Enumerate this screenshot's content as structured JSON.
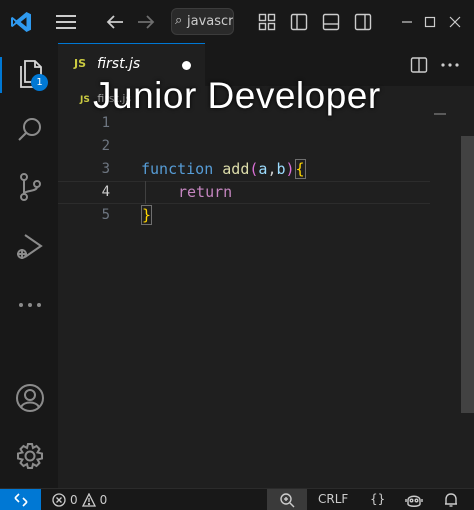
{
  "titlebar": {
    "search_text": "javascri"
  },
  "activity": {
    "explorer_badge": "1"
  },
  "tab": {
    "icon_text": "JS",
    "filename": "first.js"
  },
  "breadcrumb": {
    "icon_text": "JS",
    "text": "first.js"
  },
  "overlay": {
    "title": "Junior Developer"
  },
  "editor": {
    "line_numbers": [
      "1",
      "2",
      "3",
      "4",
      "5"
    ],
    "active_line": "4",
    "code": {
      "keyword_function": "function",
      "fn_name": "add",
      "paren_open": "(",
      "param_a": "a",
      "comma": ",",
      "param_b": "b",
      "paren_close": ")",
      "brace_open": "{",
      "keyword_return": "return",
      "brace_close": "}"
    }
  },
  "statusbar": {
    "errors": "0",
    "warnings": "0",
    "eol": "CRLF",
    "braces": "{}"
  },
  "colors": {
    "accent": "#0078d4",
    "keyword_blue": "#569cd6",
    "keyword_purple": "#c586c0",
    "function_yellow": "#dcdcaa",
    "param_blue": "#9cdcfe",
    "bracket_gold": "#ffd700",
    "bracket_purple": "#da70d6",
    "js_yellow": "#cbcb41"
  }
}
